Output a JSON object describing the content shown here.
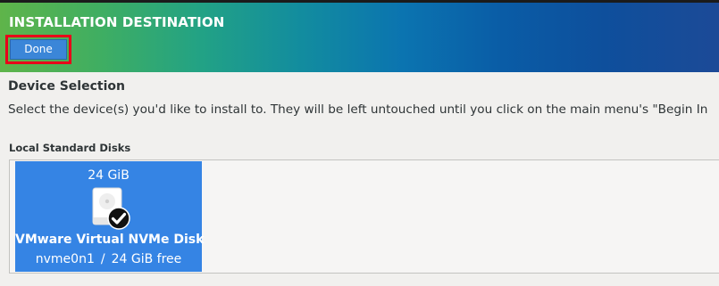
{
  "header": {
    "title": "INSTALLATION DESTINATION",
    "done_label": "Done"
  },
  "device_selection": {
    "title": "Device Selection",
    "description": "Select the device(s) you'd like to install to.  They will be left untouched until you click on the main menu's \"Begin In"
  },
  "local_disks": {
    "title": "Local Standard Disks",
    "disks": [
      {
        "size": "24 GiB",
        "name": "VMware Virtual NVMe Disk",
        "device": "nvme0n1",
        "separator": "/",
        "free": "24 GiB free",
        "selected": true,
        "icon": "hard-disk-icon",
        "status_icon": "checkmark-icon"
      }
    ]
  },
  "colors": {
    "selected_tile": "#3584e4",
    "done_button": "#3b86d8",
    "highlight_box": "#e8001a"
  }
}
